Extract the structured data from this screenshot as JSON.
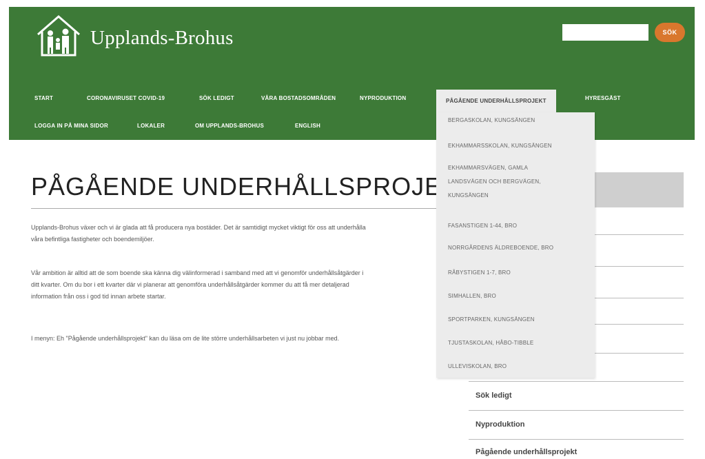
{
  "site": {
    "name": "Upplands-Brohus"
  },
  "search": {
    "placeholder": "",
    "button_label": "SÖK"
  },
  "nav": {
    "row1": [
      "START",
      "CORONAVIRUSET COVID-19",
      "SÖK LEDIGT",
      "VÅRA BOSTADSOMRÅDEN",
      "NYPRODUKTION",
      "PÅGÅENDE UNDERHÅLLSPROJEKT",
      "HYRESGÄST"
    ],
    "row2": [
      "LOGGA IN PÅ MINA SIDOR",
      "LOKALER",
      "OM UPPLANDS-BROHUS",
      "ENGLISH"
    ]
  },
  "dropdown": [
    "BERGASKOLAN, KUNGSÄNGEN",
    "EKHAMMARSSKOLAN, KUNGSÄNGEN",
    "EKHAMMARSVÄGEN, GAMLA",
    "LANDSVÄGEN OCH BERGVÄGEN,",
    "KUNGSÄNGEN",
    "FASANSTIGEN 1-44, BRO",
    "NORRGÅRDENS ÄLDREBOENDE, BRO",
    "RÅBYSTIGEN 1-7, BRO",
    "SIMHALLEN, BRO",
    "SPORTPARKEN, KUNGSÄNGEN",
    "TJUSTASKOLAN, HÅBO-TIBBLE",
    "ULLEVISKOLAN, BRO"
  ],
  "main": {
    "title": "PÅGÅENDE UNDERHÅLLSPROJEKT",
    "p1a": "Upplands-Brohus växer och vi är glada att få producera nya bostäder. Det är samtidigt mycket viktigt för oss att underhålla",
    "p1b": "våra befintliga fastigheter och boendemiljöer.",
    "p2a": "Vår ambition är alltid att de som boende ska känna dig välinformerad i samband med att vi genomför underhållsåtgärder i",
    "p2b": "ditt kvarter. Om du bor i ett kvarter där vi planerar att genomföra underhållsåtgärder kommer du att få mer detaljerad",
    "p2c": "information från oss i god tid innan arbete startar.",
    "p3": "I menyn: Eh \"Pågående underhållsprojekt\" kan du läsa om de lite större underhållsarbeten vi just nu jobbar med."
  },
  "sidebar": {
    "items": [
      "Sök ledigt",
      "Nyproduktion",
      "Pågående underhållsprojekt"
    ]
  },
  "colors": {
    "header_green": "#3d7a37",
    "search_orange": "#d9772d",
    "dropdown_bg": "#ececec"
  }
}
